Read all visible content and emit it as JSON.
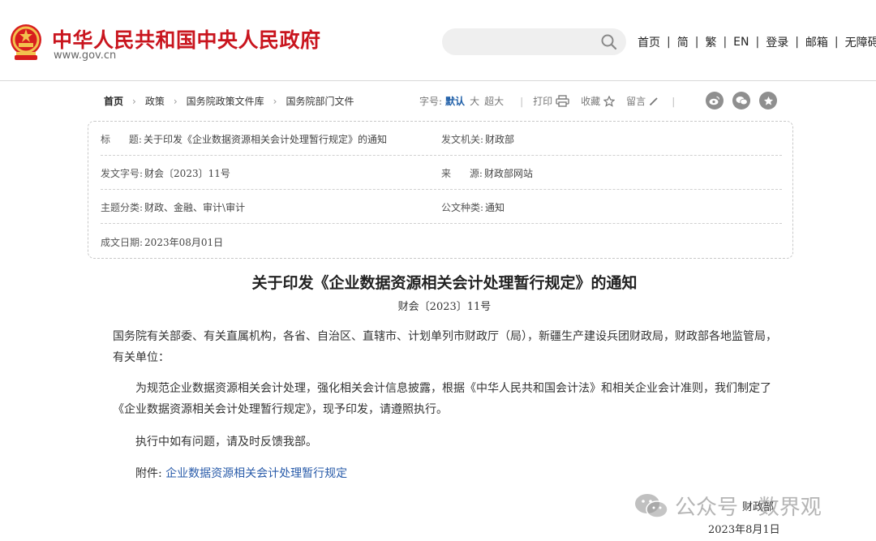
{
  "header": {
    "site_name": "中华人民共和国中央人民政府",
    "domain": "www.gov.cn",
    "search_placeholder": "",
    "nav": [
      "首页",
      "简",
      "繁",
      "EN",
      "登录",
      "邮箱",
      "无障碍"
    ]
  },
  "breadcrumb": [
    "首页",
    "政策",
    "国务院政策文件库",
    "国务院部门文件"
  ],
  "tools": {
    "font_size_label": "字号:",
    "font_sizes": [
      "默认",
      "大",
      "超大"
    ],
    "print": "打印",
    "favorite": "收藏",
    "comment": "留言"
  },
  "social_icons": [
    "weibo-icon",
    "wechat-icon",
    "star-icon"
  ],
  "meta": {
    "title_label": "标      题:",
    "title_value": "关于印发《企业数据资源相关会计处理暂行规定》的通知",
    "issuer_label": "发文机关:",
    "issuer_value": "财政部",
    "doc_no_label": "发文字号:",
    "doc_no_value": "财会〔2023〕11号",
    "source_label": "来      源:",
    "source_value": "财政部网站",
    "topic_label": "主题分类:",
    "topic_value": "财政、金融、审计\\审计",
    "type_label": "公文种类:",
    "type_value": "通知",
    "date_label": "成文日期:",
    "date_value": "2023年08月01日"
  },
  "article": {
    "title": "关于印发《企业数据资源相关会计处理暂行规定》的通知",
    "doc_no": "财会〔2023〕11号",
    "recipients": "国务院有关部委、有关直属机构，各省、自治区、直辖市、计划单列市财政厅（局），新疆生产建设兵团财政局，财政部各地监管局，有关单位：",
    "body1": "为规范企业数据资源相关会计处理，强化相关会计信息披露，根据《中华人民共和国会计法》和相关企业会计准则，我们制定了《企业数据资源相关会计处理暂行规定》，现予印发，请遵照执行。",
    "body2": "执行中如有问题，请及时反馈我部。",
    "attachment_label": "附件:",
    "attachment_link": "企业数据资源相关会计处理暂行规定",
    "signer": "财政部",
    "sign_date": "2023年8月1日"
  },
  "watermark": {
    "text": "公众号 · 数界观"
  },
  "colors": {
    "brand_red": "#c9151e",
    "link_blue": "#2a5caa",
    "active_blue": "#1f5fa8"
  }
}
